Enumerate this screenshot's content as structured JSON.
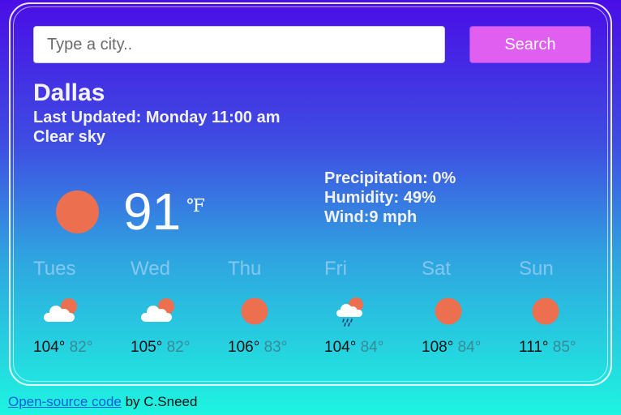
{
  "search": {
    "placeholder": "Type a city..",
    "button_label": "Search"
  },
  "current": {
    "city": "Dallas",
    "last_updated": "Last Updated: Monday 11:00 am",
    "description": "Clear sky",
    "temperature": "91",
    "unit": "℉",
    "icon": "sun-icon",
    "precipitation": "Precipitation: 0%",
    "humidity": "Humidity: 49%",
    "wind": "Wind:9 mph"
  },
  "forecast": [
    {
      "day": "Tues",
      "icon": "partly-cloudy-icon",
      "high": "104°",
      "low": "82°"
    },
    {
      "day": "Wed",
      "icon": "partly-cloudy-icon",
      "high": "105°",
      "low": "82°"
    },
    {
      "day": "Thu",
      "icon": "sun-icon",
      "high": "106°",
      "low": "83°"
    },
    {
      "day": "Fri",
      "icon": "rain-cloud-icon",
      "high": "104°",
      "low": "84°"
    },
    {
      "day": "Sat",
      "icon": "sun-icon",
      "high": "108°",
      "low": "84°"
    },
    {
      "day": "Sun",
      "icon": "sun-icon",
      "high": "111°",
      "low": "85°"
    }
  ],
  "footer": {
    "link_text": "Open-source code",
    "credit": " by C.Sneed"
  },
  "colors": {
    "sun": "#ec7050",
    "search_button": "#e05ef0",
    "day_name": "#86c6ee",
    "low_temp": "#3a8a96"
  }
}
